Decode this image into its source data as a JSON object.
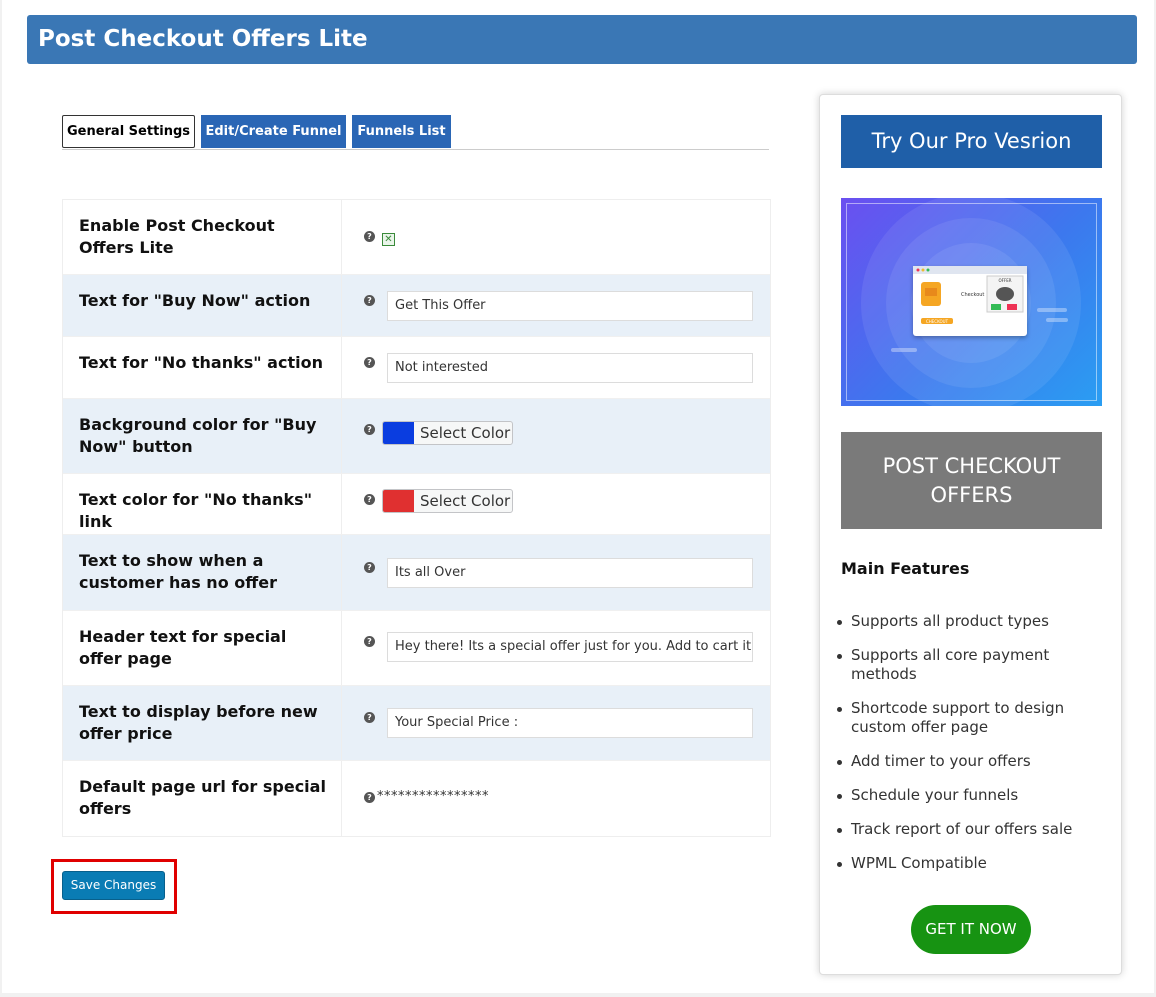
{
  "header": {
    "title": "Post Checkout Offers Lite"
  },
  "tabs": [
    {
      "label": "General Settings"
    },
    {
      "label": "Edit/Create Funnel"
    },
    {
      "label": "Funnels List"
    }
  ],
  "settings": {
    "enable": {
      "label": "Enable Post Checkout Offers Lite",
      "help": "?"
    },
    "buy_now_text": {
      "label": "Text for \"Buy Now\" action",
      "value": "Get This Offer",
      "help": "?"
    },
    "no_thanks_text": {
      "label": "Text for \"No thanks\" action",
      "value": "Not interested",
      "help": "?"
    },
    "buy_now_bg": {
      "label": "Background color for \"Buy Now\" button",
      "button": "Select Color",
      "color": "#0a3de0",
      "help": "?"
    },
    "no_thanks_color": {
      "label": "Text color for \"No thanks\" link",
      "button": "Select Color",
      "color": "#e03030",
      "help": "?"
    },
    "no_offer_text": {
      "label": "Text to show when a customer has no offer",
      "value": "Its all Over",
      "help": "?"
    },
    "header_text": {
      "label": "Header text for special offer page",
      "value": "Hey there! Its a special offer just for you. Add to cart it ar",
      "help": "?"
    },
    "price_prefix": {
      "label": "Text to display before new offer price",
      "value": "Your Special Price :",
      "help": "?"
    },
    "default_url": {
      "label": "Default page url for special offers",
      "value": "****************",
      "help": "?"
    }
  },
  "save_button": {
    "label": "Save Changes"
  },
  "sidebar": {
    "pro_button": "Try Our Pro Vesrion",
    "promo_image": {
      "checkout_label": "Checkout",
      "checkout_button": "CHECKOUT",
      "offer_label": "OFFER"
    },
    "grey_box": "POST CHECKOUT OFFERS",
    "features_title": "Main Features",
    "features": [
      "Supports all product types",
      "Supports all core payment methods",
      "Shortcode support to design custom offer page",
      "Add timer to your offers",
      "Schedule your funnels",
      "Track report of our offers sale",
      "WPML Compatible"
    ],
    "get_button": "GET IT NOW"
  }
}
